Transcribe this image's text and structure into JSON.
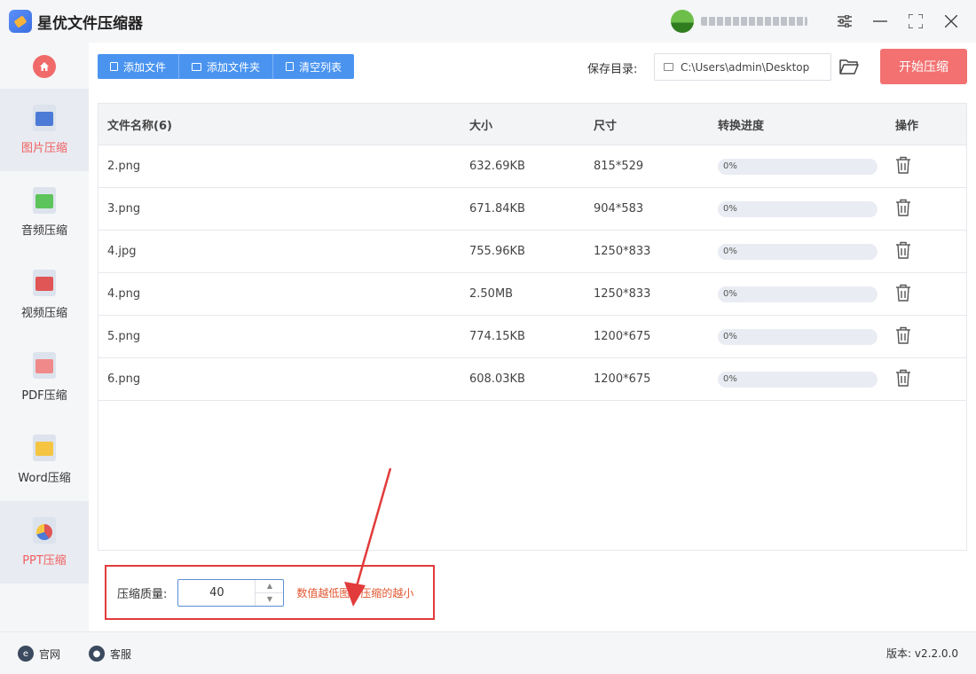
{
  "app": {
    "title": "星优文件压缩器"
  },
  "window": {
    "settings_icon": "sliders-icon",
    "minimize_icon": "minimize-icon",
    "maximize_icon": "maximize-icon",
    "close_icon": "close-icon"
  },
  "sidebar": {
    "items": [
      {
        "label": "图片压缩",
        "icon": "image-file-icon",
        "active": true
      },
      {
        "label": "音频压缩",
        "icon": "audio-file-icon"
      },
      {
        "label": "视频压缩",
        "icon": "video-file-icon"
      },
      {
        "label": "PDF压缩",
        "icon": "pdf-file-icon"
      },
      {
        "label": "Word压缩",
        "icon": "word-file-icon"
      },
      {
        "label": "PPT压缩",
        "icon": "ppt-file-icon"
      }
    ]
  },
  "toolbar": {
    "add_file": "添加文件",
    "add_folder": "添加文件夹",
    "clear_list": "清空列表",
    "save_label": "保存目录:",
    "save_path": "C:\\Users\\admin\\Desktop",
    "start": "开始压缩"
  },
  "table": {
    "headers": {
      "name": "文件名称(6)",
      "size": "大小",
      "dimension": "尺寸",
      "progress": "转换进度",
      "action": "操作"
    },
    "rows": [
      {
        "name": "2.png",
        "size": "632.69KB",
        "dimension": "815*529",
        "progress": "0%"
      },
      {
        "name": "3.png",
        "size": "671.84KB",
        "dimension": "904*583",
        "progress": "0%"
      },
      {
        "name": "4.jpg",
        "size": "755.96KB",
        "dimension": "1250*833",
        "progress": "0%"
      },
      {
        "name": "4.png",
        "size": "2.50MB",
        "dimension": "1250*833",
        "progress": "0%"
      },
      {
        "name": "5.png",
        "size": "774.15KB",
        "dimension": "1200*675",
        "progress": "0%"
      },
      {
        "name": "6.png",
        "size": "608.03KB",
        "dimension": "1200*675",
        "progress": "0%"
      }
    ]
  },
  "quality": {
    "label": "压缩质量:",
    "value": "40",
    "hint": "数值越低图片压缩的越小"
  },
  "footer": {
    "website": "官网",
    "support": "客服",
    "version": "版本: v2.2.0.0"
  },
  "colors": {
    "accent": "#4a94f0",
    "start_button": "#f37171",
    "highlight": "#e23b3b",
    "hint": "#e0552e"
  }
}
